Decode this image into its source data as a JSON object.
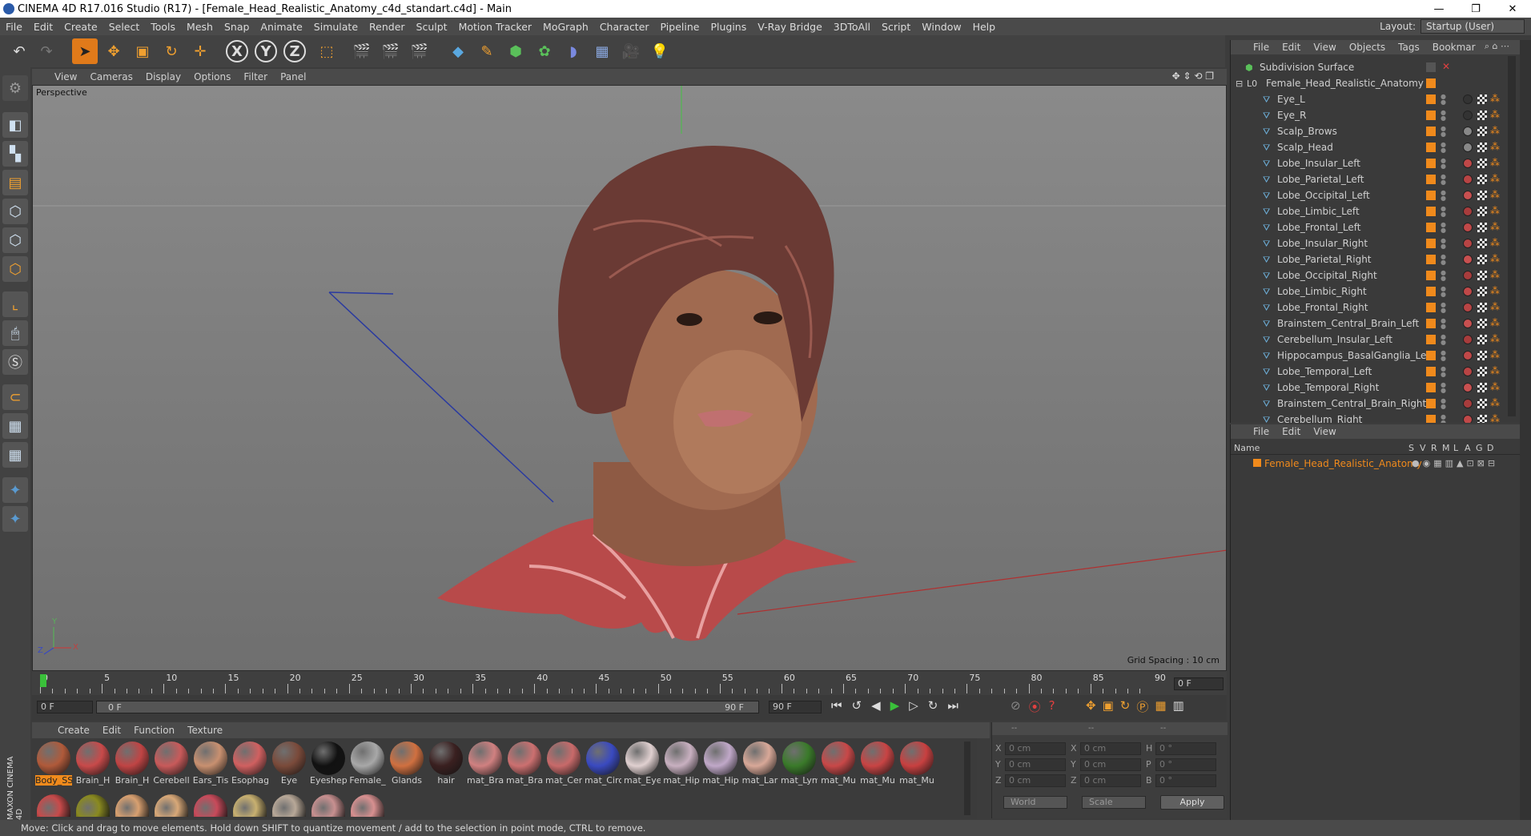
{
  "title": "CINEMA 4D R17.016 Studio (R17) - [Female_Head_Realistic_Anatomy_c4d_standart.c4d] - Main",
  "window_controls": {
    "minimize": "—",
    "maximize": "❐",
    "close": "✕"
  },
  "menu": [
    "File",
    "Edit",
    "Create",
    "Select",
    "Tools",
    "Mesh",
    "Snap",
    "Animate",
    "Simulate",
    "Render",
    "Sculpt",
    "Motion Tracker",
    "MoGraph",
    "Character",
    "Pipeline",
    "Plugins",
    "V-Ray Bridge",
    "3DToAll",
    "Script",
    "Window",
    "Help"
  ],
  "layout": {
    "label": "Layout:",
    "value": "Startup (User)"
  },
  "viewport": {
    "menu": [
      "View",
      "Cameras",
      "Display",
      "Options",
      "Filter",
      "Panel"
    ],
    "label": "Perspective",
    "grid_spacing": "Grid Spacing : 10 cm",
    "axis": {
      "x": "X",
      "y": "Y",
      "z": "Z"
    }
  },
  "timeline": {
    "ticks": [
      "0",
      "5",
      "10",
      "15",
      "20",
      "25",
      "30",
      "35",
      "40",
      "45",
      "50",
      "55",
      "60",
      "65",
      "70",
      "75",
      "80",
      "85",
      "90"
    ],
    "current_frame": "0 F",
    "start_field": "0 F",
    "range_start": "0 F",
    "range_end": "90 F",
    "end_field": "90 F"
  },
  "materials": {
    "menu": [
      "Create",
      "Edit",
      "Function",
      "Texture"
    ],
    "items": [
      {
        "label": "Body_SS",
        "color": "#b05a3a",
        "selected": true
      },
      {
        "label": "Brain_H",
        "color": "#c84a4a"
      },
      {
        "label": "Brain_H",
        "color": "#c04444"
      },
      {
        "label": "Cerebell",
        "color": "#c85a5a"
      },
      {
        "label": "Ears_Tis",
        "color": "#c89070"
      },
      {
        "label": "Esophag",
        "color": "#d06060"
      },
      {
        "label": "Eye",
        "color": "#7a4a3a"
      },
      {
        "label": "Eyeshep",
        "color": "#111111"
      },
      {
        "label": "Female_",
        "color": "#a8a8a8"
      },
      {
        "label": "Glands",
        "color": "#d07040"
      },
      {
        "label": "hair",
        "color": "#3a2020"
      },
      {
        "label": "mat_Bra",
        "color": "#d08080"
      },
      {
        "label": "mat_Bra",
        "color": "#cc7070"
      },
      {
        "label": "mat_Cer",
        "color": "#c86a6a"
      },
      {
        "label": "mat_Circ",
        "color": "#3a4ac0"
      },
      {
        "label": "mat_Eye",
        "color": "#e0d0d0"
      },
      {
        "label": "mat_Hip",
        "color": "#c8b0c0"
      },
      {
        "label": "mat_Hip",
        "color": "#c0a8c8"
      },
      {
        "label": "mat_Lar",
        "color": "#d8a898"
      },
      {
        "label": "mat_Lym",
        "color": "#3a7a2a"
      },
      {
        "label": "mat_Mu",
        "color": "#c84848"
      },
      {
        "label": "mat_Mu",
        "color": "#c84444"
      },
      {
        "label": "mat_Mu",
        "color": "#c84040"
      }
    ],
    "row2": [
      "#c84a4a",
      "#8a8a20",
      "#d8a070",
      "#d8a878",
      "#c84a5a",
      "#c8b070",
      "#b8a898",
      "#c89090",
      "#d89090"
    ]
  },
  "coords": {
    "headers": [
      "--",
      "--",
      "--"
    ],
    "rows": [
      {
        "a": "X",
        "av": "0 cm",
        "b": "X",
        "bv": "0 cm",
        "c": "H",
        "cv": "0 °"
      },
      {
        "a": "Y",
        "av": "0 cm",
        "b": "Y",
        "bv": "0 cm",
        "c": "P",
        "cv": "0 °"
      },
      {
        "a": "Z",
        "av": "0 cm",
        "b": "Z",
        "bv": "0 cm",
        "c": "B",
        "cv": "0 °"
      }
    ],
    "space": "World",
    "mode": "Scale",
    "apply": "Apply"
  },
  "object_manager": {
    "menu": [
      "File",
      "Edit",
      "View",
      "Objects",
      "Tags",
      "Bookmar"
    ],
    "root": "Subdivision Surface",
    "group": "Female_Head_Realistic_Anatomy",
    "children": [
      "Eye_L",
      "Eye_R",
      "Scalp_Brows",
      "Scalp_Head",
      "Lobe_Insular_Left",
      "Lobe_Parietal_Left",
      "Lobe_Occipital_Left",
      "Lobe_Limbic_Left",
      "Lobe_Frontal_Left",
      "Lobe_Insular_Right",
      "Lobe_Parietal_Right",
      "Lobe_Occipital_Right",
      "Lobe_Limbic_Right",
      "Lobe_Frontal_Right",
      "Brainstem_Central_Brain_Left",
      "Cerebellum_Insular_Left",
      "Hippocampus_BasalGanglia_Left",
      "Lobe_Temporal_Left",
      "Lobe_Temporal_Right",
      "Brainstem_Central_Brain_Right",
      "Cerebellum_Right"
    ]
  },
  "layer_manager": {
    "menu": [
      "File",
      "Edit",
      "View"
    ],
    "columns": [
      "Name",
      "S",
      "V",
      "R",
      "M",
      "L",
      "A",
      "G",
      "D"
    ],
    "layer": "Female_Head_Realistic_Anatomy"
  },
  "status": "Move: Click and drag to move elements. Hold down SHIFT to quantize movement / add to the selection in point mode, CTRL to remove.",
  "accent": "#f08a1c"
}
